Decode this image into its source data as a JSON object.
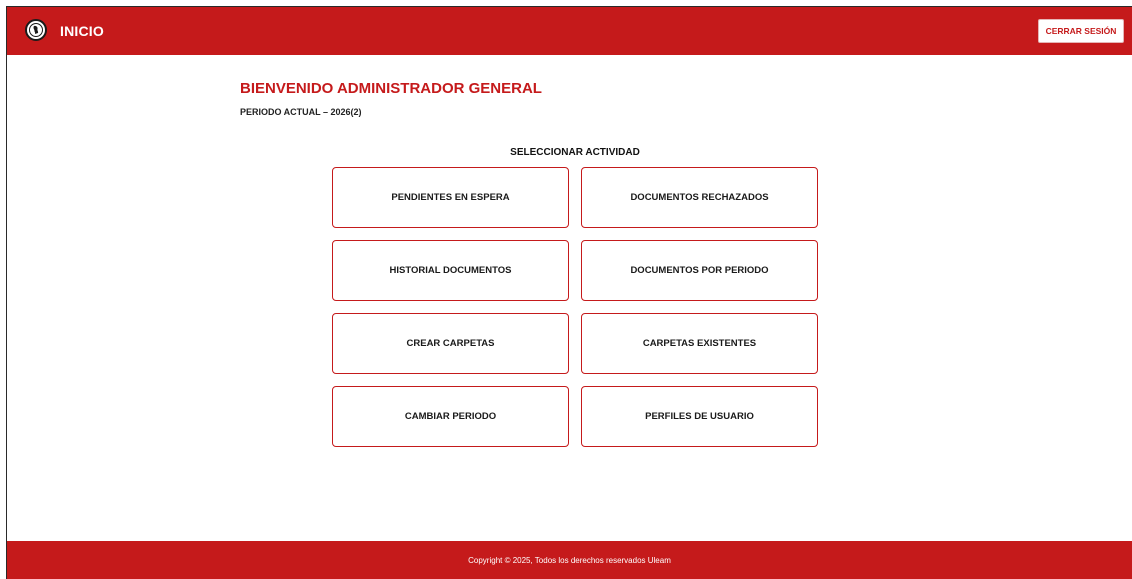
{
  "header": {
    "title": "INICIO",
    "logo_icon": "university-seal-icon",
    "logout_label": "CERRAR SESIÓN",
    "brand_color": "#c51a1b"
  },
  "main": {
    "welcome": "BIENVENIDO ADMINISTRADOR GENERAL",
    "period": "PERIODO ACTUAL – 2026(2)",
    "select_title": "SELECCIONAR ACTIVIDAD",
    "activities": [
      {
        "label": "PENDIENTES EN ESPERA"
      },
      {
        "label": "DOCUMENTOS RECHAZADOS"
      },
      {
        "label": "HISTORIAL DOCUMENTOS"
      },
      {
        "label": "DOCUMENTOS POR PERIODO"
      },
      {
        "label": "CREAR CARPETAS"
      },
      {
        "label": "CARPETAS EXISTENTES"
      },
      {
        "label": "CAMBIAR PERIODO"
      },
      {
        "label": "PERFILES DE USUARIO"
      }
    ]
  },
  "footer": {
    "copyright": "Copyright © 2025, Todos los derechos reservados Uleam"
  }
}
